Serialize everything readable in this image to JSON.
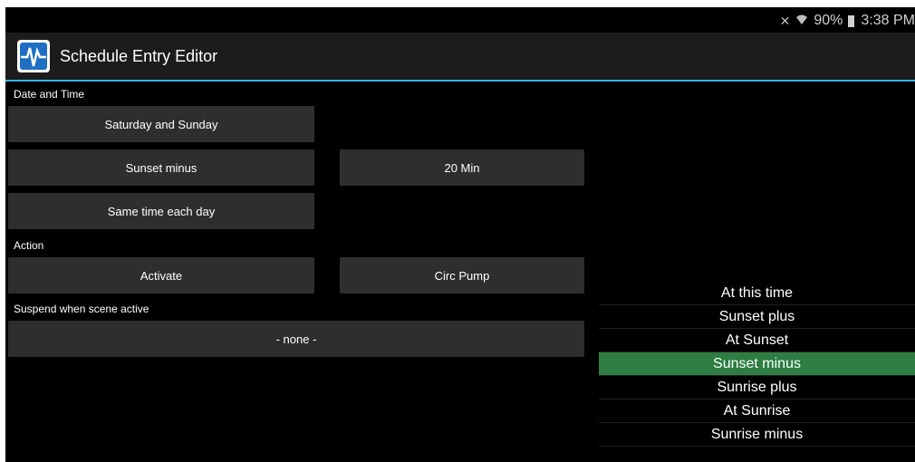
{
  "status": {
    "battery_text": "90%",
    "time": "3:38 PM"
  },
  "app": {
    "title": "Schedule Entry Editor"
  },
  "date_time": {
    "heading": "Date and Time",
    "days_button": "Saturday and Sunday",
    "mode_button": "Sunset minus",
    "offset_button": "20 Min",
    "repeat_button": "Same time each day"
  },
  "action": {
    "heading": "Action",
    "action_button": "Activate",
    "target_button": "Circ Pump"
  },
  "suspend": {
    "heading": "Suspend when scene active",
    "scene_button": "- none -"
  },
  "picker": {
    "items": [
      {
        "label": "At this time"
      },
      {
        "label": "Sunset plus"
      },
      {
        "label": "At Sunset"
      },
      {
        "label": "Sunset minus"
      },
      {
        "label": "Sunrise plus"
      },
      {
        "label": "At Sunrise"
      },
      {
        "label": "Sunrise minus"
      }
    ],
    "selected": "Sunset minus"
  },
  "colors": {
    "accent_line": "#33b5e5",
    "selected_item": "#2e7d42",
    "button_bg": "#2e2e2e",
    "app_icon_blue": "#1e6fc2"
  }
}
